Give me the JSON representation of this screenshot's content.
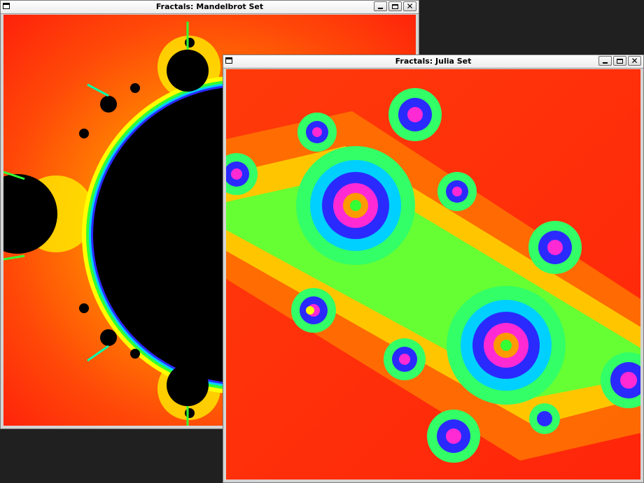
{
  "windows": {
    "mandelbrot": {
      "title": "Fractals: Mandelbrot Set",
      "buttons": [
        "minimize",
        "maximize",
        "close"
      ],
      "colors": {
        "background": "#ff2a0a",
        "set": "#000000",
        "edge": [
          "#ffff00",
          "#33ff33",
          "#00c8ff",
          "#2a2aff",
          "#ff2ad4"
        ]
      }
    },
    "julia": {
      "title": "Fractals: Julia Set",
      "buttons": [
        "minimize",
        "maximize",
        "close"
      ],
      "colors": {
        "background": "#ff2a0a",
        "mid": "#33ff33",
        "core": [
          "#00c8ff",
          "#2a2aff",
          "#ff2ad4"
        ]
      }
    }
  },
  "icons": {
    "window": "window-icon",
    "minimize": "minimize-icon",
    "maximize": "maximize-icon",
    "close": "close-icon"
  }
}
